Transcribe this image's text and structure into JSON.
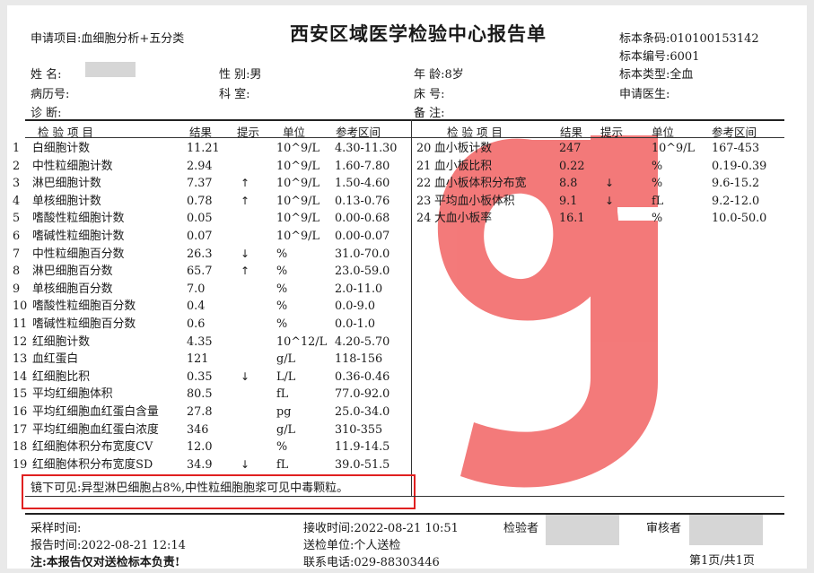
{
  "report": {
    "title": "西安区域医学检验中心报告单",
    "request_item": "申请项目:血细胞分析+五分类",
    "barcode": "标本条码:010100153142",
    "specimen_no": "标本编号:6001",
    "specimen_type": "标本类型:全血",
    "requesting_doctor": "申请医生:",
    "name_label": "姓    名:",
    "sex": "性    别:男",
    "age": "年    龄:8岁",
    "record_no": "病历号:",
    "department": "科    室:",
    "bed": "床    号:",
    "diagnosis": "诊    断:",
    "remarks": "备    注:"
  },
  "table_headers": {
    "item": "检  验  项  目",
    "result": "结果",
    "flag": "提示",
    "unit": "单位",
    "ref": "参考区间"
  },
  "left_rows": [
    {
      "no": "1",
      "item": "白细胞计数",
      "result": "11.21",
      "flag": "",
      "unit": "10^9/L",
      "ref": "4.30-11.30"
    },
    {
      "no": "2",
      "item": "中性粒细胞计数",
      "result": "2.94",
      "flag": "",
      "unit": "10^9/L",
      "ref": "1.60-7.80"
    },
    {
      "no": "3",
      "item": "淋巴细胞计数",
      "result": "7.37",
      "flag": "↑",
      "unit": "10^9/L",
      "ref": "1.50-4.60"
    },
    {
      "no": "4",
      "item": "单核细胞计数",
      "result": "0.78",
      "flag": "↑",
      "unit": "10^9/L",
      "ref": "0.13-0.76"
    },
    {
      "no": "5",
      "item": "嗜酸性粒细胞计数",
      "result": "0.05",
      "flag": "",
      "unit": "10^9/L",
      "ref": "0.00-0.68"
    },
    {
      "no": "6",
      "item": "嗜碱性粒细胞计数",
      "result": "0.07",
      "flag": "",
      "unit": "10^9/L",
      "ref": "0.00-0.07"
    },
    {
      "no": "7",
      "item": "中性粒细胞百分数",
      "result": "26.3",
      "flag": "↓",
      "unit": "%",
      "ref": "31.0-70.0"
    },
    {
      "no": "8",
      "item": "淋巴细胞百分数",
      "result": "65.7",
      "flag": "↑",
      "unit": "%",
      "ref": "23.0-59.0"
    },
    {
      "no": "9",
      "item": "单核细胞百分数",
      "result": "7.0",
      "flag": "",
      "unit": "%",
      "ref": "2.0-11.0"
    },
    {
      "no": "10",
      "item": "嗜酸性粒细胞百分数",
      "result": "0.4",
      "flag": "",
      "unit": "%",
      "ref": "0.0-9.0"
    },
    {
      "no": "11",
      "item": "嗜碱性粒细胞百分数",
      "result": "0.6",
      "flag": "",
      "unit": "%",
      "ref": "0.0-1.0"
    },
    {
      "no": "12",
      "item": "红细胞计数",
      "result": "4.35",
      "flag": "",
      "unit": "10^12/L",
      "ref": "4.20-5.70"
    },
    {
      "no": "13",
      "item": "血红蛋白",
      "result": "121",
      "flag": "",
      "unit": "g/L",
      "ref": "118-156"
    },
    {
      "no": "14",
      "item": "红细胞比积",
      "result": "0.35",
      "flag": "↓",
      "unit": "L/L",
      "ref": "0.36-0.46"
    },
    {
      "no": "15",
      "item": "平均红细胞体积",
      "result": "80.5",
      "flag": "",
      "unit": "fL",
      "ref": "77.0-92.0"
    },
    {
      "no": "16",
      "item": "平均红细胞血红蛋白含量",
      "result": "27.8",
      "flag": "",
      "unit": "pg",
      "ref": "25.0-34.0"
    },
    {
      "no": "17",
      "item": "平均红细胞血红蛋白浓度",
      "result": "346",
      "flag": "",
      "unit": "g/L",
      "ref": "310-355"
    },
    {
      "no": "18",
      "item": "红细胞体积分布宽度CV",
      "result": "12.0",
      "flag": "",
      "unit": "%",
      "ref": "11.9-14.5"
    },
    {
      "no": "19",
      "item": "红细胞体积分布宽度SD",
      "result": "34.9",
      "flag": "↓",
      "unit": "fL",
      "ref": "39.0-51.5"
    }
  ],
  "right_rows": [
    {
      "no": "20",
      "item": "血小板计数",
      "result": "247",
      "flag": "",
      "unit": "10^9/L",
      "ref": "167-453"
    },
    {
      "no": "21",
      "item": "血小板比积",
      "result": "0.22",
      "flag": "",
      "unit": "%",
      "ref": "0.19-0.39"
    },
    {
      "no": "22",
      "item": "血小板体积分布宽",
      "result": "8.8",
      "flag": "↓",
      "unit": "%",
      "ref": "9.6-15.2"
    },
    {
      "no": "23",
      "item": "平均血小板体积",
      "result": "9.1",
      "flag": "↓",
      "unit": "fL",
      "ref": "9.2-12.0"
    },
    {
      "no": "24",
      "item": "大血小板率",
      "result": "16.1",
      "flag": "",
      "unit": "%",
      "ref": "10.0-50.0"
    }
  ],
  "microscopy_note": "镜下可见:异型淋巴细胞占8%,中性粒细胞胞浆可见中毒颗粒。",
  "footer": {
    "collect_time": "采样时间:",
    "report_time": "报告时间:2022-08-21 12:14",
    "disclaimer": "注:本报告仅对送检标本负责!",
    "receive_time": "接收时间:2022-08-21 10:51",
    "submit_unit": "送检单位:个人送检",
    "phone": "联系电话:029-88303446",
    "examiner": "检验者",
    "reviewer": "审核者",
    "page": "第1页/共1页"
  },
  "colors": {
    "watermark": "#f26b6b",
    "highlight_box": "#e02020",
    "redaction": "#d6d6d6"
  }
}
